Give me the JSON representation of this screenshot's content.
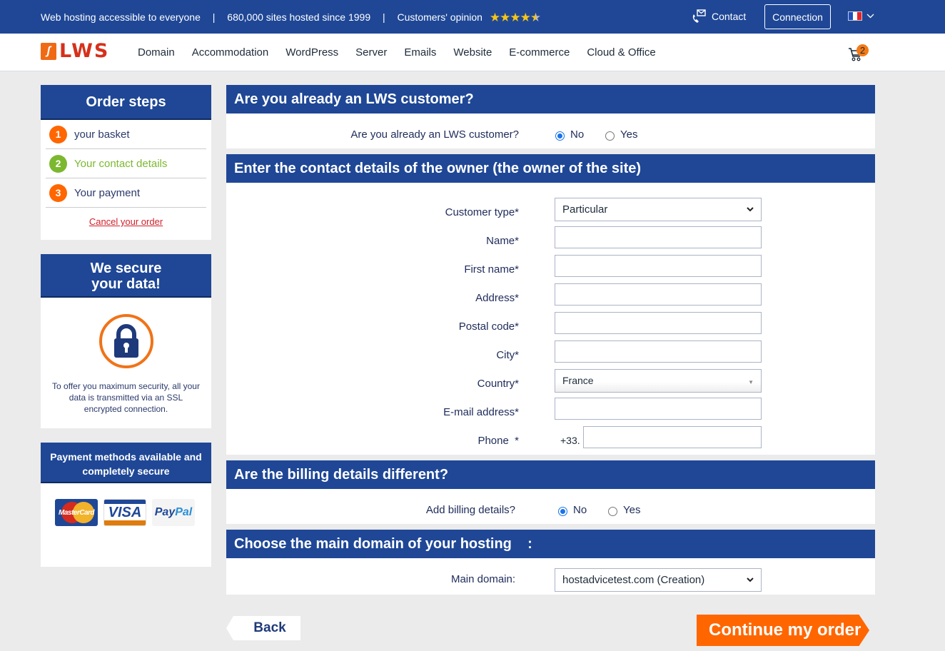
{
  "topbar": {
    "tagline_1": "Web hosting accessible to everyone",
    "separator": "|",
    "tagline_2": "680,000 sites hosted since 1999",
    "tagline_3": "Customers' opinion",
    "rating_stars": 4.5,
    "contact_label": "Contact",
    "connection_label": "Connection",
    "language": "French",
    "flag_colors": [
      "#1f4fbf",
      "#ffffff",
      "#e5252c"
    ]
  },
  "nav": {
    "logo_text": "LWS",
    "items": [
      "Domain",
      "Accommodation",
      "WordPress",
      "Server",
      "Emails",
      "Website",
      "E-commerce",
      "Cloud & Office"
    ],
    "cart_count": "2"
  },
  "sidebar": {
    "order_steps": {
      "title": "Order steps",
      "steps": [
        {
          "num": "1",
          "label": "your basket",
          "color": "#ff6600",
          "text_color": "#2b3a6b"
        },
        {
          "num": "2",
          "label": "Your contact details",
          "color": "#7cb82f",
          "text_color": "#7cb82f"
        },
        {
          "num": "3",
          "label": "Your payment",
          "color": "#ff6600",
          "text_color": "#2b3a6b"
        }
      ],
      "cancel_label": "Cancel your order"
    },
    "secure": {
      "title_line1": "We secure",
      "title_line2": "your data!",
      "text": "To offer you maximum security, all your data is transmitted via an SSL encrypted connection."
    },
    "payment": {
      "title": "Payment methods available and completely secure",
      "methods": [
        "MasterCard",
        "VISA",
        "PayPal"
      ]
    }
  },
  "sections": {
    "customer": {
      "title": "Are you already an LWS customer?",
      "question": "Are you already an LWS customer?",
      "options": [
        "No",
        "Yes"
      ],
      "selected": "No"
    },
    "contact": {
      "title": "Enter the contact details of the owner (the owner of the site)",
      "fields": {
        "customer_type": {
          "label": "Customer type*",
          "value": "Particular"
        },
        "name": {
          "label": "Name*",
          "value": ""
        },
        "first_name": {
          "label": "First name*",
          "value": ""
        },
        "address": {
          "label": "Address*",
          "value": ""
        },
        "postal_code": {
          "label": "Postal code*",
          "value": ""
        },
        "city": {
          "label": "City*",
          "value": ""
        },
        "country": {
          "label": "Country*",
          "value": "France"
        },
        "email": {
          "label": "E-mail address*",
          "value": ""
        },
        "phone": {
          "label": "Phone  *",
          "prefix": "+33.",
          "value": ""
        }
      }
    },
    "billing": {
      "title": "Are the billing details different?",
      "question": "Add billing details?",
      "options": [
        "No",
        "Yes"
      ],
      "selected": "No"
    },
    "domain": {
      "title": "Choose the main domain of your hosting    :",
      "label": "Main domain:",
      "value": "hostadvicetest.com (Creation)"
    }
  },
  "buttons": {
    "back": "Back",
    "continue": "Continue my order"
  },
  "colors": {
    "brand_blue": "#1f4796",
    "accent_orange": "#ff6600",
    "step_active_green": "#7cb82f",
    "cancel_red": "#d0202a"
  }
}
